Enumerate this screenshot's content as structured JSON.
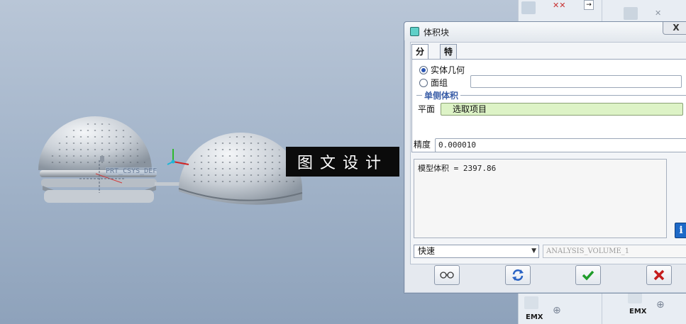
{
  "viewport": {
    "csys_label": "PRT_CSYS_DEF",
    "watermark_text": "图文设计",
    "background_color": "#a5b6cb"
  },
  "toolbar": {
    "emx_label_1": "EMX",
    "emx_label_2": "EMX"
  },
  "dialog": {
    "title": "体积块",
    "close_label": "X",
    "tabs": [
      {
        "label": "分析",
        "active": true
      },
      {
        "label": "特征",
        "active": false
      }
    ],
    "radio_solid": "实体几何",
    "radio_quilt": "面组",
    "quilt_value": "",
    "group_title": "单侧体积",
    "plane_label": "平面",
    "plane_value": "选取项目",
    "precision_label": "精度",
    "precision_value": "0.000010",
    "result_text": "模型体积 = 2397.86",
    "info_icon": "i",
    "mode_value": "快速",
    "analysis_name": "ANALYSIS_VOLUME_1",
    "buttons": [
      {
        "name": "glasses-icon"
      },
      {
        "name": "repeat-icon"
      },
      {
        "name": "ok-icon"
      },
      {
        "name": "cancel-icon"
      }
    ],
    "colors": {
      "ok": "#1f9c2a",
      "cancel": "#c51d1d",
      "highlight": "#ddf3c6",
      "accent": "#3a5ea8"
    }
  }
}
